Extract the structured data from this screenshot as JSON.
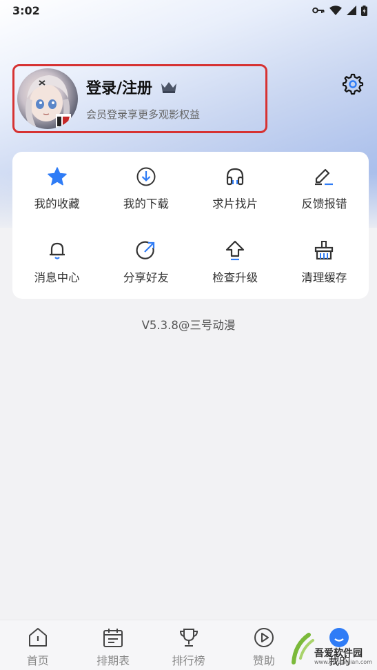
{
  "status_bar": {
    "time": "3:02",
    "icons": [
      "key-icon",
      "wifi-icon",
      "signal-icon",
      "battery-icon"
    ]
  },
  "profile": {
    "title": "登录/注册",
    "subtitle": "会员登录享更多观影权益",
    "crown_icon": "crown-icon",
    "highlight_color": "#d63232"
  },
  "settings": {
    "icon": "gear-icon"
  },
  "menu": [
    {
      "label": "我的收藏",
      "icon": "star-icon"
    },
    {
      "label": "我的下载",
      "icon": "download-icon"
    },
    {
      "label": "求片找片",
      "icon": "headphones-icon"
    },
    {
      "label": "反馈报错",
      "icon": "edit-icon"
    },
    {
      "label": "消息中心",
      "icon": "bell-icon"
    },
    {
      "label": "分享好友",
      "icon": "share-icon"
    },
    {
      "label": "检查升级",
      "icon": "upgrade-icon"
    },
    {
      "label": "清理缓存",
      "icon": "broom-icon"
    }
  ],
  "version": "V5.3.8@三号动漫",
  "bottom_nav": [
    {
      "label": "首页",
      "icon": "home-icon"
    },
    {
      "label": "排期表",
      "icon": "calendar-icon"
    },
    {
      "label": "排行榜",
      "icon": "trophy-icon"
    },
    {
      "label": "赞助",
      "icon": "play-circle-icon"
    },
    {
      "label": "我的",
      "icon": "profile-icon",
      "active": true
    }
  ],
  "watermark": {
    "text": "吾爱软件园",
    "url": "www.52ruanjian.com"
  },
  "colors": {
    "accent": "#2f7cf6",
    "text": "#333333",
    "muted": "#888888"
  }
}
